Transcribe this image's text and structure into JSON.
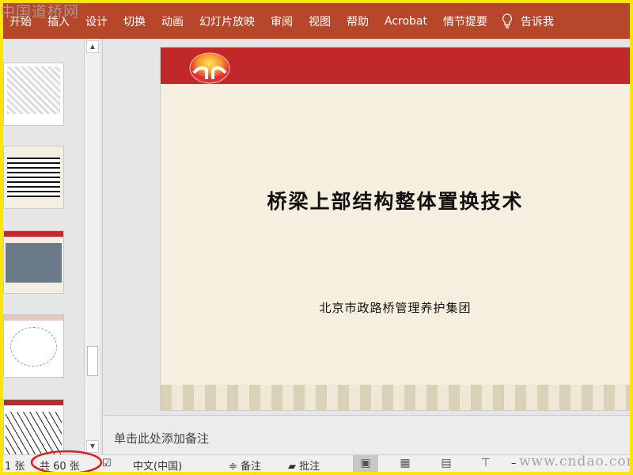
{
  "watermark": "中国道桥网",
  "ribbon": {
    "tabs": [
      "开始",
      "插入",
      "设计",
      "切换",
      "动画",
      "幻灯片放映",
      "审阅",
      "视图",
      "帮助",
      "Acrobat",
      "情节提要"
    ],
    "tell_me": "告诉我"
  },
  "slide": {
    "title": "桥梁上部结构整体置换技术",
    "subtitle": "北京市政路桥管理养护集团"
  },
  "notes": {
    "placeholder": "单击此处添加备注"
  },
  "status": {
    "slide_index": "1 张",
    "slide_total": "共 60 张",
    "language": "中文(中国)",
    "notes_label": "备注",
    "comments_label": "批注",
    "watermark": "www.cndao.com"
  },
  "colors": {
    "ribbon": "#b7472a",
    "slide_bar": "#c0282a",
    "highlight_circle": "#e02020"
  }
}
